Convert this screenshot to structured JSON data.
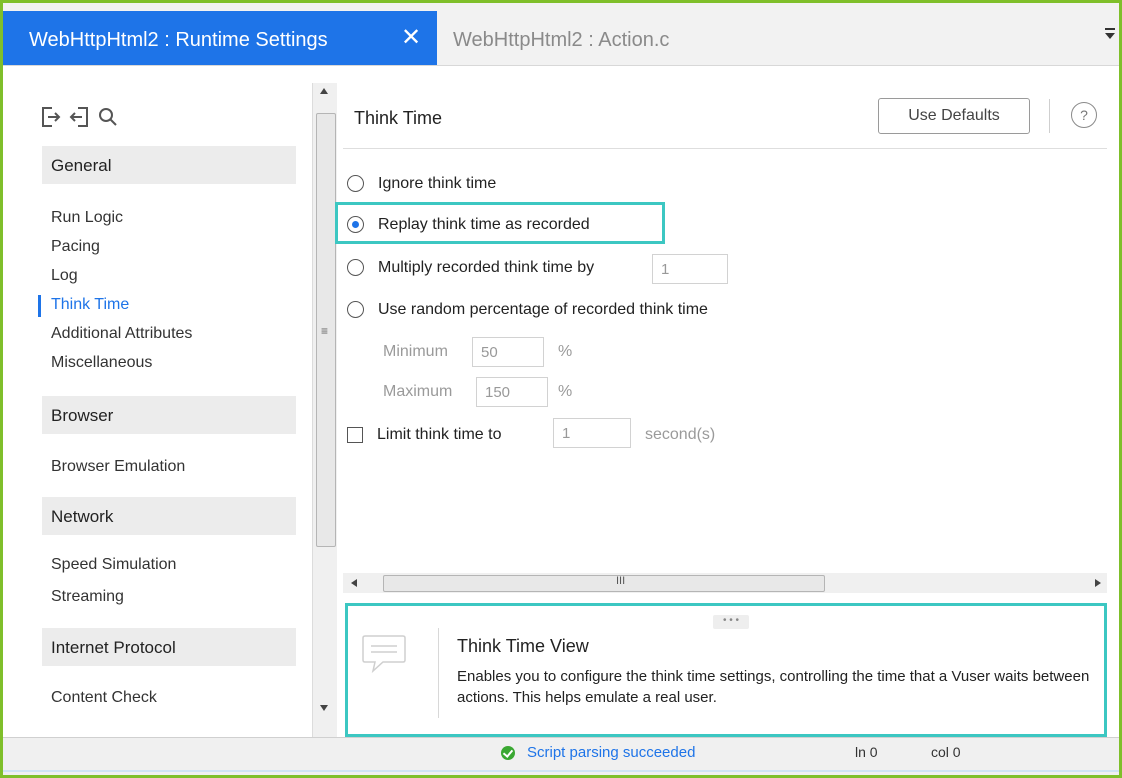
{
  "tabs": {
    "active_label": "WebHttpHtml2 : Runtime Settings",
    "close_glyph": "✕",
    "second_label": "WebHttpHtml2 : Action.c"
  },
  "sidebar": {
    "icons": [
      "export-icon",
      "import-icon",
      "search-icon"
    ],
    "sections": [
      {
        "title": "General",
        "items": [
          "Run Logic",
          "Pacing",
          "Log",
          "Think Time",
          "Additional Attributes",
          "Miscellaneous"
        ]
      },
      {
        "title": "Browser",
        "items": [
          "Browser Emulation"
        ]
      },
      {
        "title": "Network",
        "items": [
          "Speed Simulation",
          "Streaming"
        ]
      },
      {
        "title": "Internet Protocol",
        "items": [
          "Content Check"
        ]
      }
    ],
    "active_item": "Think Time"
  },
  "main": {
    "title": "Think Time",
    "use_defaults_label": "Use Defaults",
    "help_glyph": "?",
    "options": {
      "ignore": "Ignore think time",
      "replay": "Replay think time as recorded",
      "multiply": "Multiply recorded think time by",
      "multiply_value": "1",
      "random": "Use random percentage of recorded think time",
      "minimum_label": "Minimum",
      "minimum_value": "50",
      "maximum_label": "Maximum",
      "maximum_value": "150",
      "percent": "%",
      "limit": "Limit think time to",
      "limit_value": "1",
      "limit_unit": "second(s)"
    },
    "selected_option": "replay",
    "scroll_grip": "III",
    "info_panel": {
      "title": "Think Time View",
      "body": "Enables you to configure the think time settings, controlling the time that a Vuser waits between actions. This helps emulate a real user.",
      "grip": "• • •"
    }
  },
  "status_bar": {
    "message": "Script parsing succeeded",
    "line": "ln 0",
    "col": "col 0"
  },
  "colors": {
    "accent": "#1e74e8",
    "highlight": "#3cc7c2",
    "success": "#3aa832"
  }
}
